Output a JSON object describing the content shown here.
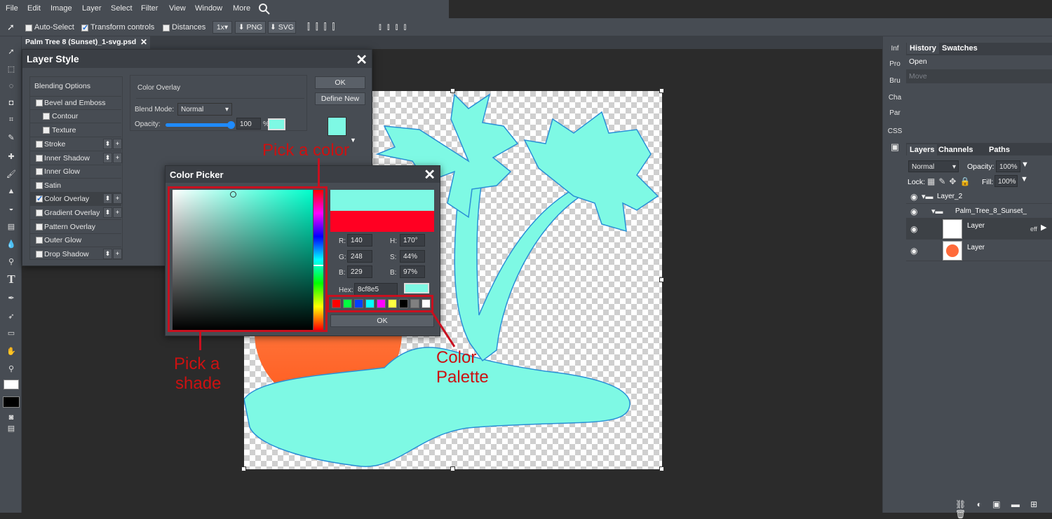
{
  "menu": [
    "File",
    "Edit",
    "Image",
    "Layer",
    "Select",
    "Filter",
    "View",
    "Window",
    "More"
  ],
  "options": {
    "auto_select": "Auto-Select",
    "transform": "Transform controls",
    "distances": "Distances",
    "zoom": "1x",
    "png": "PNG",
    "svg": "SVG"
  },
  "doc_tab": "Palm Tree 8 (Sunset)_1-svg.psd",
  "right_strip": [
    "Inf",
    "Pro",
    "Bru",
    "Cha",
    "Par",
    "CSS"
  ],
  "history": {
    "tabs": [
      "History",
      "Swatches"
    ],
    "items": [
      "Open",
      "Move"
    ]
  },
  "layers": {
    "tabs": [
      "Layers",
      "Channels",
      "Paths"
    ],
    "blend": "Normal",
    "opacity_label": "Opacity:",
    "opacity": "100%",
    "lock_label": "Lock:",
    "fill_label": "Fill:",
    "fill": "100%",
    "rows": [
      "Layer_2",
      "Palm_Tree_8_Sunset_",
      "Layer",
      "Layer"
    ],
    "eff": "eff"
  },
  "layer_style": {
    "title": "Layer Style",
    "items": [
      "Blending Options",
      "Bevel and Emboss",
      "Contour",
      "Texture",
      "Stroke",
      "Inner Shadow",
      "Inner Glow",
      "Satin",
      "Color Overlay",
      "Gradient Overlay",
      "Pattern Overlay",
      "Outer Glow",
      "Drop Shadow"
    ],
    "section": "Color Overlay",
    "blend_label": "Blend Mode:",
    "blend": "Normal",
    "opacity_label": "Opacity:",
    "opacity": "100",
    "percent": "%",
    "ok": "OK",
    "define_new": "Define New"
  },
  "color_picker": {
    "title": "Color Picker",
    "r_label": "R:",
    "r": "140",
    "g_label": "G:",
    "g": "248",
    "b_label": "B:",
    "b": "229",
    "h_label": "H:",
    "h": "170°",
    "s_label": "S:",
    "s": "44%",
    "v_label": "B:",
    "v": "97%",
    "hex_label": "Hex:",
    "hex": "8cf8e5",
    "ok": "OK",
    "palette": [
      "#ff0000",
      "#00ff40",
      "#0040ff",
      "#00ffff",
      "#ff00ff",
      "#ffff40",
      "#000000",
      "#808080",
      "#ffffff"
    ]
  },
  "annotations": {
    "pick_color": "Pick a color",
    "pick_shade_1": "Pick a",
    "pick_shade_2": "shade",
    "palette_1": "Color",
    "palette_2": "Palette"
  },
  "colors": {
    "new": "#7ef9e4",
    "old": "#ff0022",
    "accent": "#c8101f"
  }
}
